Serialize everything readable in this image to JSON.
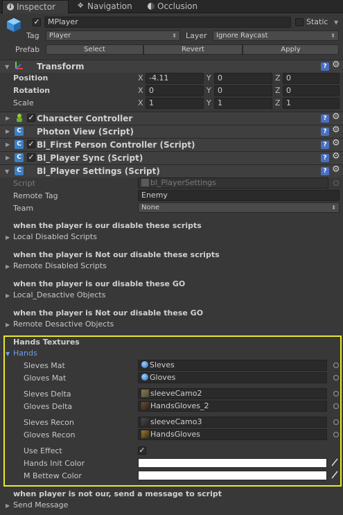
{
  "tabs": [
    {
      "label": "Inspector"
    },
    {
      "label": "Navigation"
    },
    {
      "label": "Occlusion"
    }
  ],
  "object": {
    "name": "MPlayer",
    "static_label": "Static",
    "tag_label": "Tag",
    "tag_value": "Player",
    "layer_label": "Layer",
    "layer_value": "Ignore Raycast",
    "prefab_label": "Prefab",
    "prefab_buttons": [
      "Select",
      "Revert",
      "Apply"
    ]
  },
  "transform": {
    "title": "Transform",
    "rows": [
      {
        "label": "Position",
        "x": "-4.11",
        "y": "0",
        "z": "0"
      },
      {
        "label": "Rotation",
        "x": "0",
        "y": "0",
        "z": "0"
      },
      {
        "label": "Scale",
        "x": "1",
        "y": "1",
        "z": "1"
      }
    ],
    "axes": [
      "X",
      "Y",
      "Z"
    ]
  },
  "components": [
    {
      "title": "Character Controller"
    },
    {
      "title": "Photon View (Script)"
    },
    {
      "title": "Bl_First Person Controller (Script)"
    },
    {
      "title": "Bl_Player Sync (Script)"
    },
    {
      "title": "Bl_Player Settings (Script)"
    }
  ],
  "settings": {
    "script_label": "Script",
    "script_value": "bl_PlayerSettings",
    "remote_tag_label": "Remote Tag",
    "remote_tag_value": "Enemy",
    "team_label": "Team",
    "team_value": "None",
    "sections": [
      {
        "heading": "when the player is our disable these scripts",
        "list": "Local Disabled Scripts"
      },
      {
        "heading": "when the player is Not our disable these scripts",
        "list": "Remote Disabled Scripts"
      },
      {
        "heading": "when the player is our disable these GO",
        "list": "Local_Desactive Objects"
      },
      {
        "heading": "when the player is Not our disable these GO",
        "list": "Remote Desactive Objects"
      }
    ],
    "hands_textures_heading": "Hands Textures",
    "hands_fold": "Hands",
    "hands_fields": [
      {
        "label": "Sleves Mat",
        "value": "Sleves"
      },
      {
        "label": "Gloves Mat",
        "value": "Gloves"
      },
      {
        "label": "Sleves Delta",
        "value": "sleeveCamo2"
      },
      {
        "label": "Gloves Delta",
        "value": "HandsGloves_2"
      },
      {
        "label": "Sleves Recon",
        "value": "sleeveCamo3"
      },
      {
        "label": "Gloves Recon",
        "value": "HandsGloves"
      }
    ],
    "use_effect_label": "Use Effect",
    "hands_init_color_label": "Hands Init Color",
    "m_bettew_color_label": "M Bettew Color",
    "message_heading": "when player is not our, send a message to script",
    "send_message_label": "Send Message"
  },
  "colors": {
    "highlight_border": "#e8e830",
    "hands_fold": "#6b9df0"
  },
  "icons": {
    "help": "help-icon",
    "gear": "gear-icon",
    "script": "script-icon",
    "object_picker": "object-picker-icon"
  }
}
